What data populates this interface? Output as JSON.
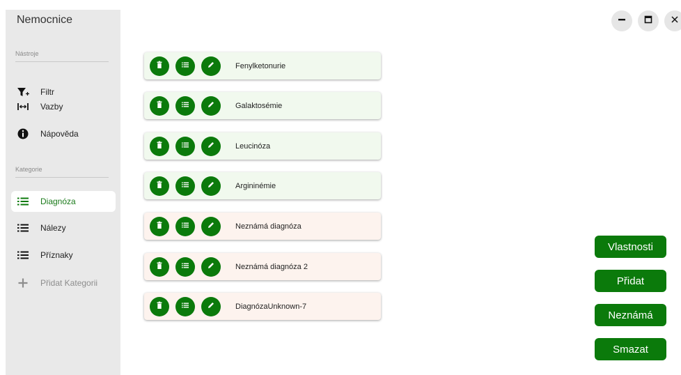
{
  "app": {
    "title": "Nemocnice"
  },
  "sidebar": {
    "tools_label": "Nástroje",
    "tools": [
      {
        "label": "Filtr",
        "icon": "filter-plus-icon"
      },
      {
        "label": "Vazby",
        "icon": "link-arrows-icon"
      },
      {
        "label": "Nápověda",
        "icon": "info-icon"
      }
    ],
    "categories_label": "Kategorie",
    "categories": [
      {
        "label": "Diagnóza",
        "icon": "list-icon",
        "selected": true
      },
      {
        "label": "Nálezy",
        "icon": "list-icon"
      },
      {
        "label": "Příznaky",
        "icon": "list-icon"
      },
      {
        "label": "Přidat Kategorii",
        "icon": "plus-icon"
      }
    ]
  },
  "window_controls": [
    "minimize",
    "maximize",
    "close"
  ],
  "items": [
    {
      "name": "Fenylketonurie",
      "state": "known"
    },
    {
      "name": "Galaktosémie",
      "state": "known"
    },
    {
      "name": "Leucinóza",
      "state": "known"
    },
    {
      "name": "Argininémie",
      "state": "known"
    },
    {
      "name": "Neznámá diagnóza",
      "state": "unknown"
    },
    {
      "name": "Neznámá diagnóza 2",
      "state": "unknown"
    },
    {
      "name": "DiagnózaUnknown-7",
      "state": "unknown"
    }
  ],
  "actions": {
    "properties": "Vlastnosti",
    "add": "Přidat",
    "unknown": "Neznámá",
    "delete": "Smazat"
  },
  "colors": {
    "accent": "#0b7a0b",
    "sidebar_bg": "#e9e9e9",
    "known_row_bg": "#f1f9ee",
    "unknown_row_bg": "#fdf3ee"
  }
}
